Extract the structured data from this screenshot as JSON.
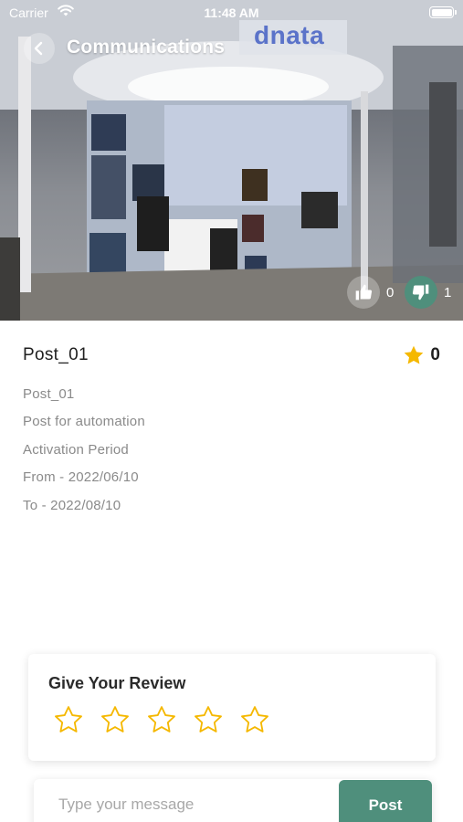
{
  "status_bar": {
    "carrier": "Carrier",
    "time": "11:48 AM"
  },
  "header": {
    "title": "Communications"
  },
  "hero": {
    "brand_sign": "dnata",
    "likes": "0",
    "dislikes": "1"
  },
  "post": {
    "title": "Post_01",
    "rating": "0",
    "details": [
      "Post_01",
      "Post for automation",
      "Activation Period",
      "From - 2022/06/10",
      "To - 2022/08/10"
    ]
  },
  "review": {
    "title": "Give Your Review",
    "max_stars": 5,
    "selected_stars": 0
  },
  "message": {
    "placeholder": "Type your message",
    "value": "",
    "post_label": "Post"
  },
  "colors": {
    "accent": "#4f8f7c",
    "star": "#f5b800",
    "muted_text": "#8a8a8a"
  },
  "icons": {
    "back": "arrow-left-icon",
    "like": "thumbs-up-icon",
    "dislike": "thumbs-down-icon",
    "rating": "star-filled-icon",
    "review_star": "star-outline-icon"
  }
}
